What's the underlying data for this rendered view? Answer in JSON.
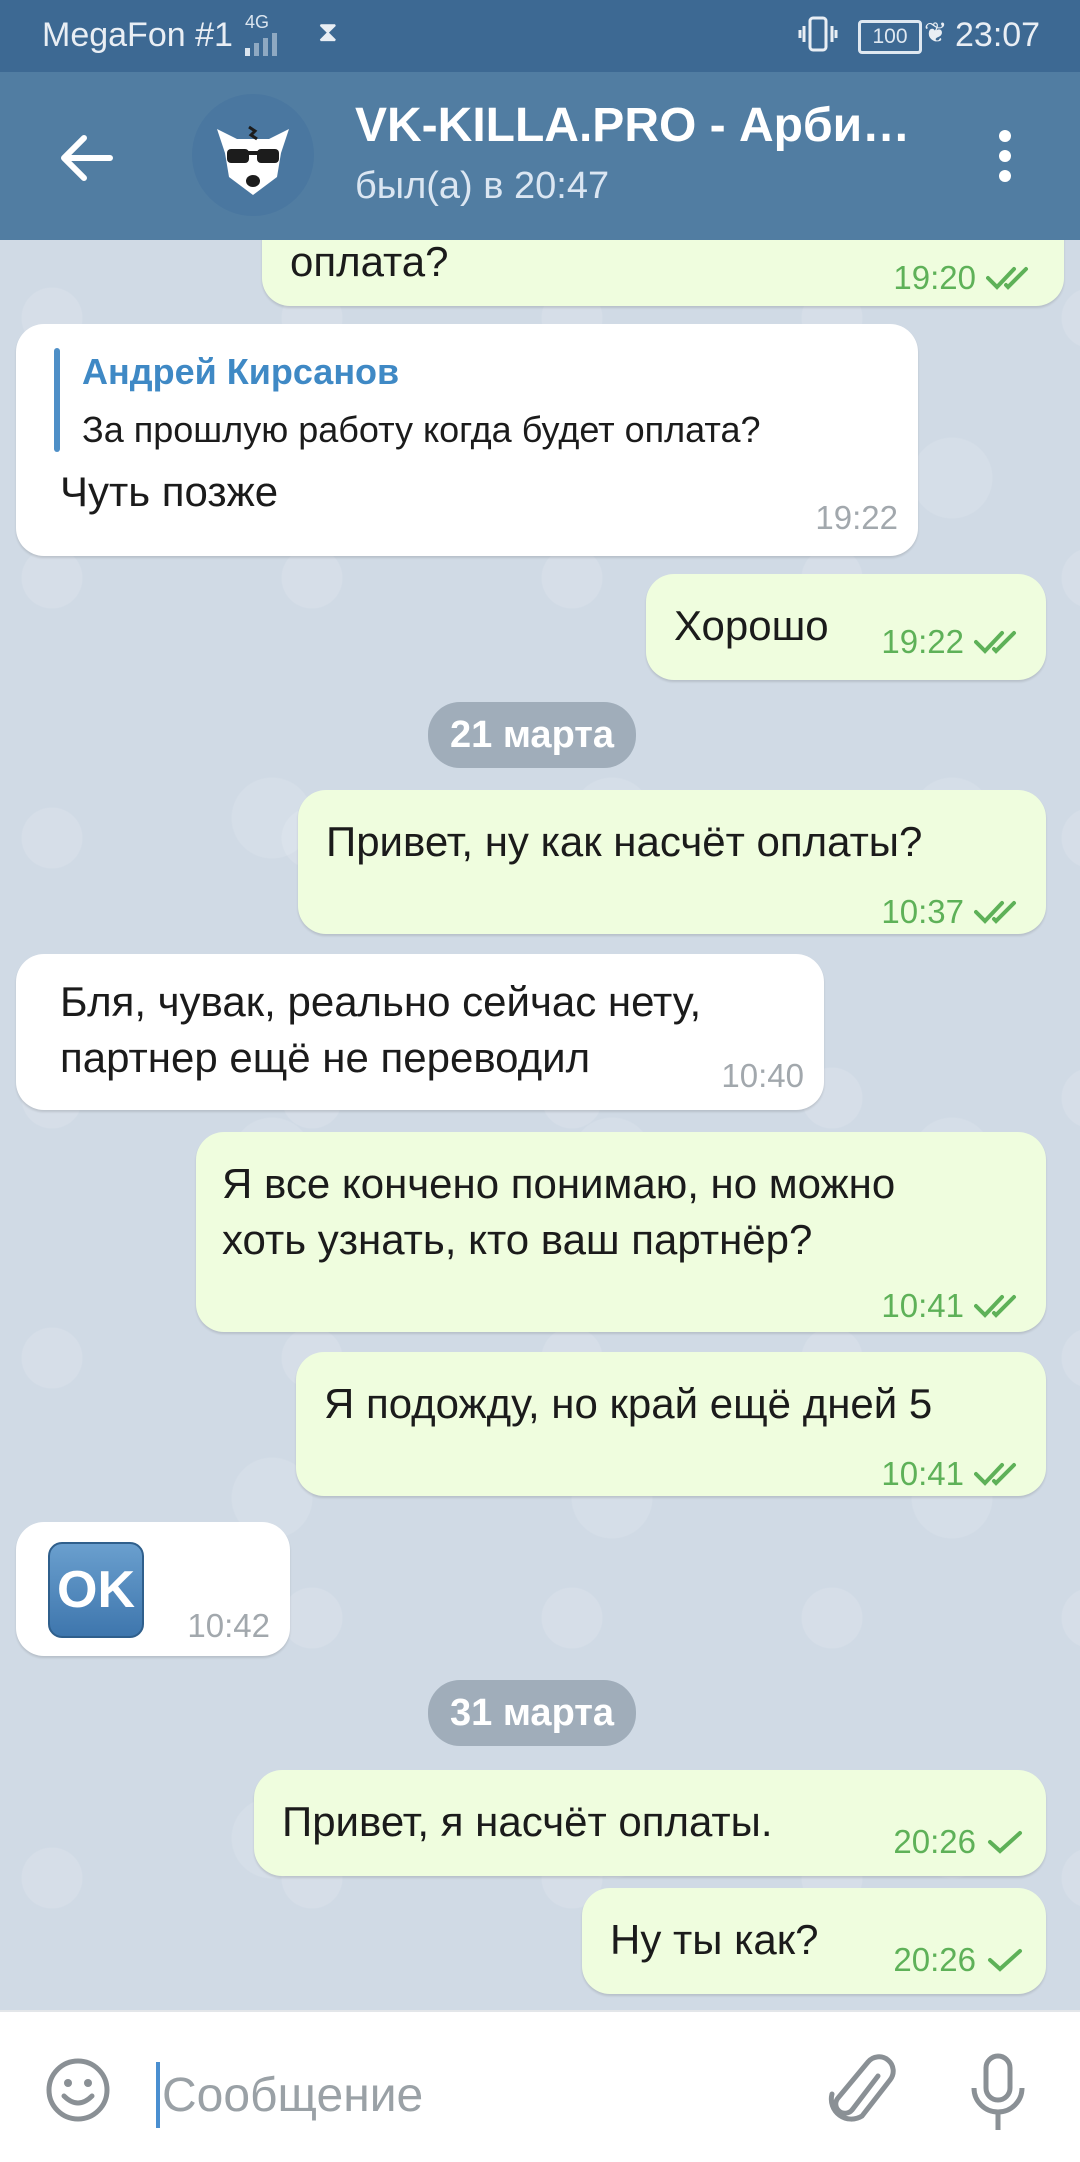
{
  "status_bar": {
    "carrier": "MegaFon #1",
    "network": "4G",
    "battery": "100",
    "time": "23:07"
  },
  "header": {
    "title": "VK-KILLA.PRO - Арби…",
    "status": "был(а) в 20:47"
  },
  "messages": [
    {
      "text": "оплата?",
      "time": "19:20",
      "read": true
    },
    {
      "reply_author": "Андрей Кирсанов",
      "reply_text": "За прошлую работу когда будет оплата?",
      "text": "Чуть позже",
      "time": "19:22"
    },
    {
      "text": "Хорошо",
      "time": "19:22",
      "read": true
    },
    {
      "date": "21 марта"
    },
    {
      "text": "Привет, ну как насчёт оплаты?",
      "time": "10:37",
      "read": true
    },
    {
      "line1": "Бля, чувак, реально сейчас нету,",
      "line2": "партнер ещё не переводил",
      "time": "10:40"
    },
    {
      "line1": "Я все кончено понимаю, но можно",
      "line2": "хоть узнать, кто ваш партнёр?",
      "time": "10:41",
      "read": true
    },
    {
      "text": "Я подожду, но край ещё дней 5",
      "time": "10:41",
      "read": true
    },
    {
      "sticker": "OK",
      "time": "10:42"
    },
    {
      "date": "31 марта"
    },
    {
      "text": "Привет, я насчёт оплаты.",
      "time": "20:26",
      "read": false
    },
    {
      "text": "Ну ты как?",
      "time": "20:26",
      "read": false
    }
  ],
  "composer": {
    "placeholder": "Сообщение"
  },
  "colors": {
    "header": "#517da2",
    "status_bar": "#3d6993",
    "outgoing_bubble": "#effdde",
    "incoming_bubble": "#ffffff",
    "check": "#5eb158"
  }
}
